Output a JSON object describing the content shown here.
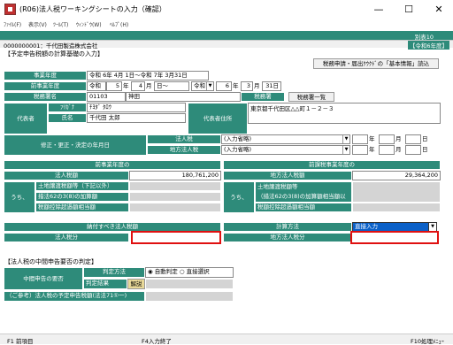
{
  "window": {
    "title": "(R06)法人税ワーキングシートの入力（確認）",
    "min": "—",
    "max": "☐",
    "close": "✕"
  },
  "menu": [
    "ﾌｧｲﾙ(F)",
    "表示(V)",
    "ﾂｰﾙ(T)",
    "ｳｨﾝﾄﾞｳ(W)",
    "ﾍﾙﾌﾟ(H)"
  ],
  "sheet_no": "別表10",
  "company": "0000000001：千代田製造株式会社",
  "era": "【令和6年度】",
  "section1": "【予定申告税額の計算基礎の入力】",
  "link_button": "税務申請・届出ｸｳｸﾄﾞの「基本情報」読込",
  "labels": {
    "fiscal_year": "事業年度",
    "prev_fiscal": "前事業年度",
    "tax_office": "税務署名",
    "tax_office_mid": "税務署",
    "tax_office_list": "税務署一覧",
    "rep": "代表者",
    "furigana": "ﾌﾘｶﾞﾅ",
    "name": "氏名",
    "address": "代表者住所",
    "revision": "修正・更正・決定の年月日",
    "corp_tax": "法人税",
    "local_tax": "地方法人税",
    "prev_fy": "前事業年度の",
    "prev_fy2": "前課税事業年度の",
    "corp_amt": "法人税額",
    "local_amt": "地方法人税額",
    "sub": "うち、",
    "land": "土地譲渡税額等（下記以外）",
    "land2": "措法62の3(8)の加算額",
    "land3": "税額控除超過額相当額",
    "local_land": "土地譲渡税額等",
    "local_land_b": "（措法62の3(8)の加算額相当額以外）",
    "local_land3": "税額控除超過額相当額",
    "to_pay": "納付すべき法人税額",
    "calc": "計算方法",
    "corp_tax_amt": "法人税分",
    "local_tax_amt": "地方法人税分",
    "section2": "【法人税の中間申告要否の判定】",
    "need": "中間申告の要否",
    "judge_method": "判定方法",
    "judge_result": "判定結果",
    "explain": "解説",
    "reference": "（ご参考）法人税の予定申告税額(法法71①一)",
    "auto": "自動判定",
    "direct": "直接選択"
  },
  "values": {
    "fy": "令和 6年 4月 1日～令和 7年 3月31日",
    "prev_era1": "令和",
    "prev_y1": "5",
    "prev_m1": "4",
    "prev_d1": "日～",
    "prev_era2": "令和",
    "prev_y2": "6",
    "prev_m2": "3",
    "prev_d2": "31日",
    "prev_nen": "年",
    "prev_tsuki": "月",
    "office_code": "01103",
    "office_name": "神田",
    "furigana": "ﾁﾖﾀﾞ ﾀﾛｳ",
    "name": "千代田 太郎",
    "address": "東京都千代田区△△町１－２－３",
    "corp_select": "(入力省略)",
    "local_select": "(入力省略)",
    "ymd": [
      "年",
      "月",
      "日"
    ],
    "corp_amount": "180,761,200",
    "local_amount": "29,364,200",
    "calc_select": "直接入力"
  },
  "footer": {
    "f1": "F1 前項目",
    "f4": "F4入力終了",
    "f10": "F10処理ﾒﾆｭｰ"
  }
}
